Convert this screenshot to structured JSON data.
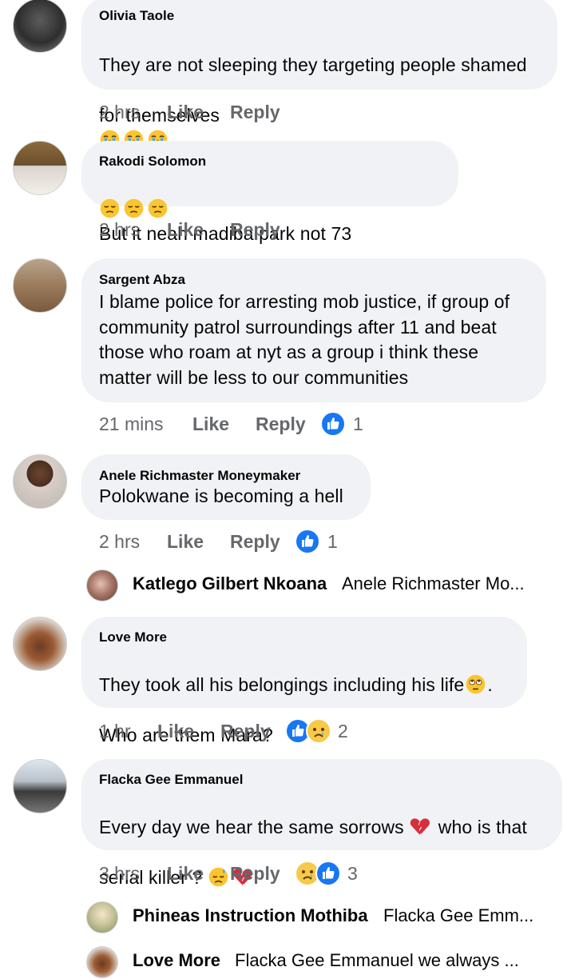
{
  "comments": [
    {
      "author": "Olivia Taole",
      "text_line1": "They are not sleeping they targeting people shamed",
      "text_line2": "for themselves",
      "time": "2 hrs",
      "like": "Like",
      "reply": "Reply"
    },
    {
      "author": "Rakodi Solomon",
      "text": "But it neah madiba park not 73",
      "time": "2 hrs",
      "like": "Like",
      "reply": "Reply"
    },
    {
      "author": "Sargent Abza",
      "text": "I blame police for arresting mob justice, if group of\ncommunity patrol surroundings after 11 and beat\nthose who roam at nyt as a group i think these\nmatter will be less to our communities",
      "time": "21 mins",
      "like": "Like",
      "reply": "Reply",
      "reaction_count": "1"
    },
    {
      "author": "Anele Richmaster Moneymaker",
      "text": "Polokwane is becoming a hell",
      "time": "2 hrs",
      "like": "Like",
      "reply": "Reply",
      "reaction_count": "1",
      "reply_preview": {
        "name": "Katlego Gilbert Nkoana",
        "snippet": "Anele Richmaster Mo..."
      }
    },
    {
      "author": "Love More",
      "text_line1": "They took all his belongings including his life",
      "text_line1_end": ".",
      "text_line2": "Who are them Mara?",
      "time": "1 hr",
      "like": "Like",
      "reply": "Reply",
      "reaction_count": "2"
    },
    {
      "author": "Flacka Gee Emmanuel",
      "text_line1a": "Every day  we hear the same sorrows",
      "text_line1b": "who is that",
      "text_line2": "serial killer  ?",
      "time": "3 hrs",
      "like": "Like",
      "reply": "Reply",
      "reaction_count": "3",
      "replies": [
        {
          "name": "Phineas Instruction Mothiba",
          "snippet": "Flacka Gee Emm..."
        },
        {
          "name": "Love More",
          "snippet": "Flacka Gee Emmanuel we always ..."
        }
      ]
    }
  ],
  "icons": {
    "like": "like-reaction-icon",
    "sad": "sad-reaction-icon",
    "crying": "crying-emoji-icon",
    "pensive": "pensive-emoji-icon",
    "eye_roll": "eye-roll-emoji-icon",
    "broken_heart": "broken-heart-emoji-icon",
    "sweat": "downcast-sweat-emoji-icon"
  },
  "colors": {
    "bubble": "#f0f2f5",
    "meta_text": "#65676b",
    "like_blue": "#1877f2"
  }
}
